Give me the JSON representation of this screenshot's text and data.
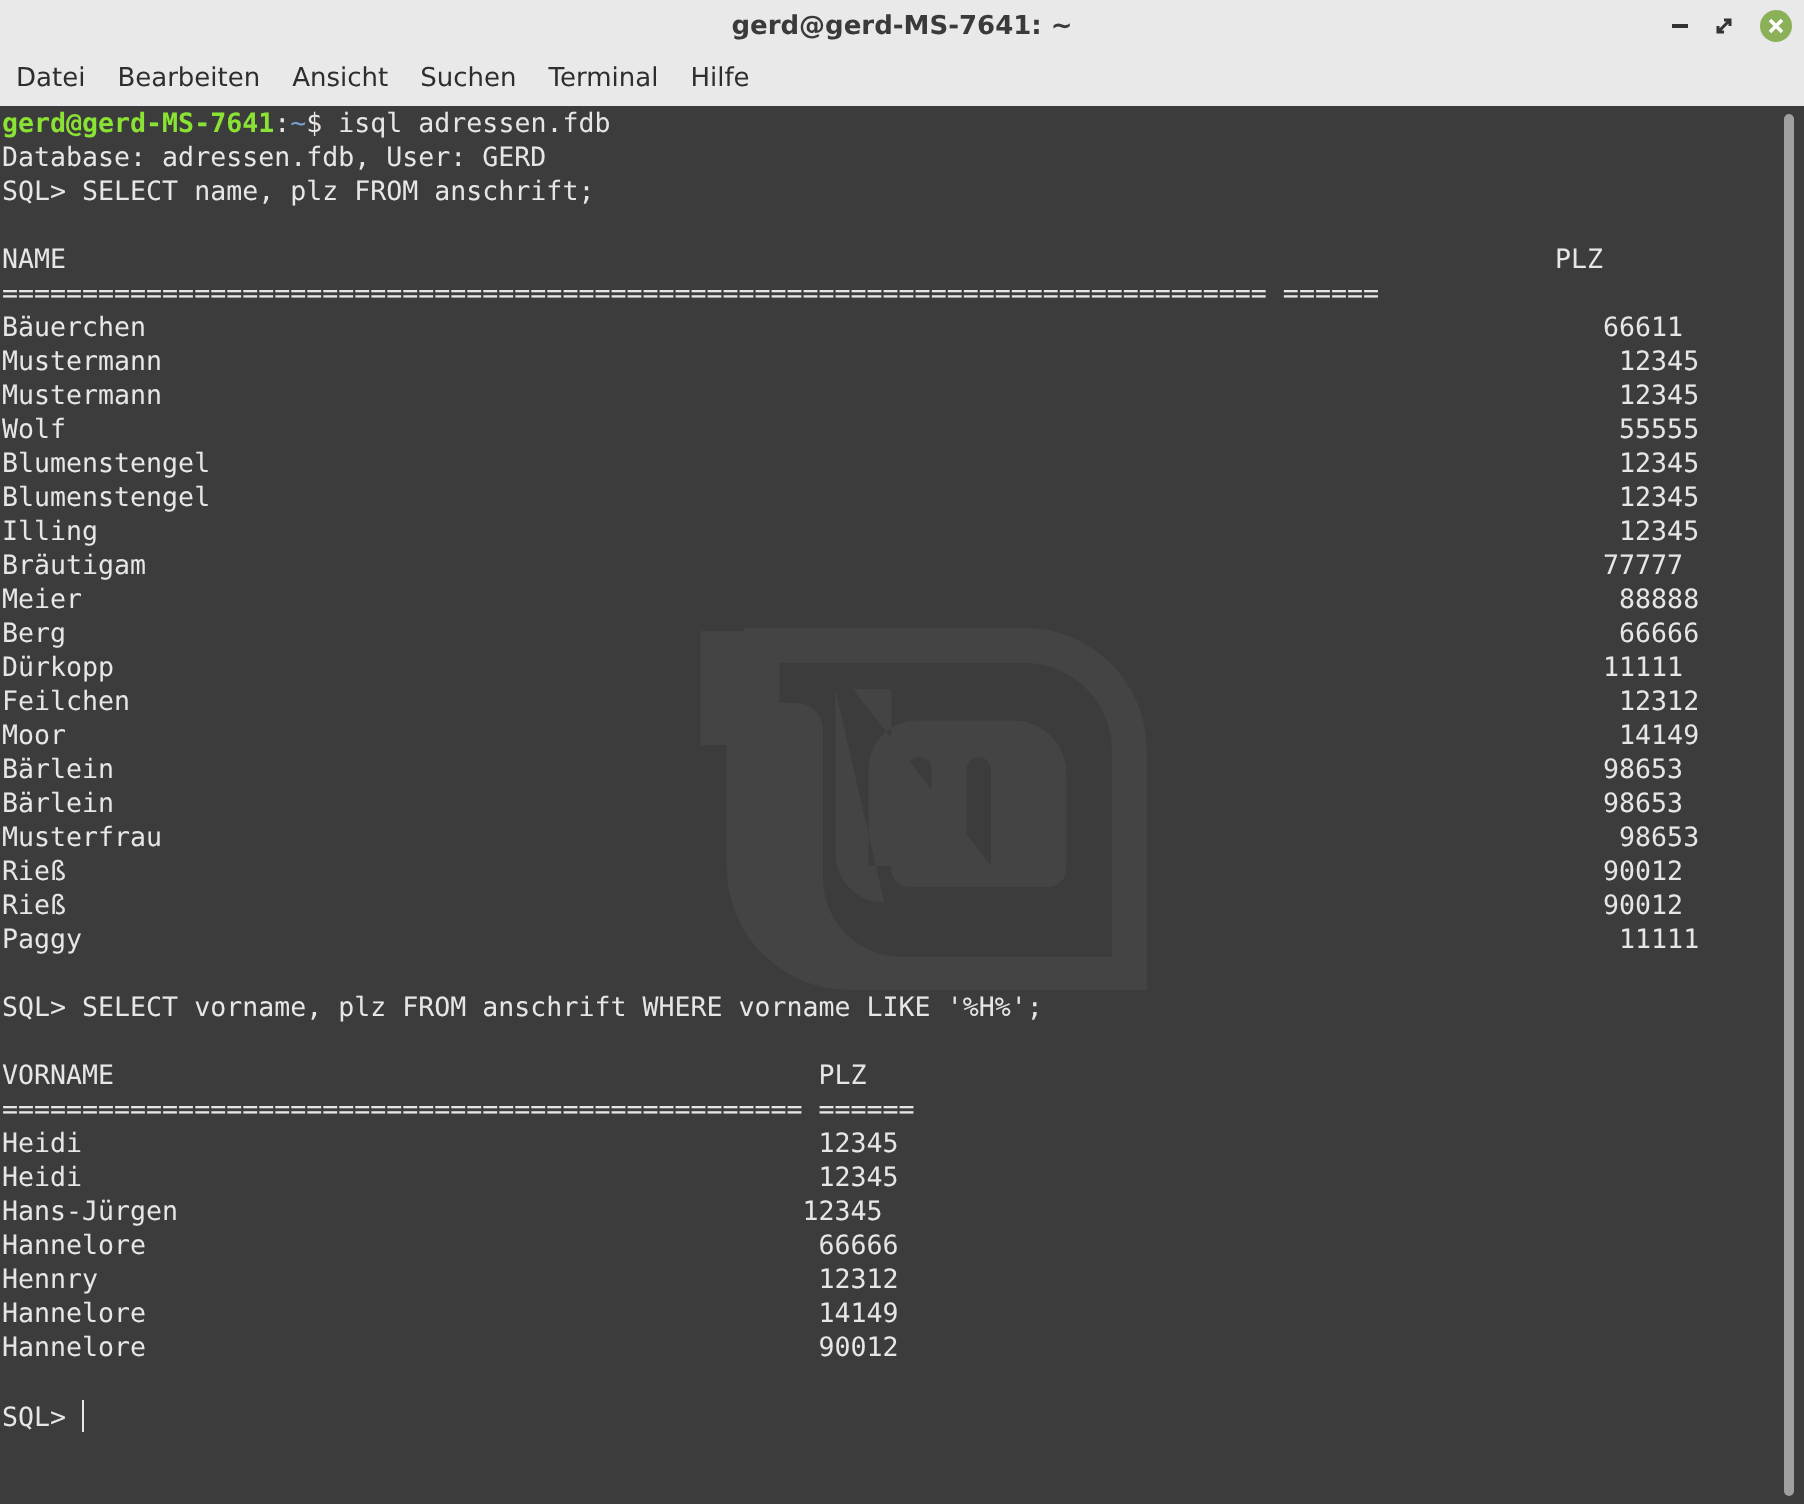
{
  "window": {
    "title": "gerd@gerd-MS-7641: ~"
  },
  "menu": [
    "Datei",
    "Bearbeiten",
    "Ansicht",
    "Suchen",
    "Terminal",
    "Hilfe"
  ],
  "terminal": {
    "lines": [
      {
        "kind": "prompt",
        "user_host": "gerd@gerd-MS-7641",
        "colon": ":",
        "path": "~",
        "command": "$ isql adressen.fdb"
      },
      {
        "kind": "output",
        "text": "Database: adressen.fdb, User: GERD"
      },
      {
        "kind": "output",
        "text": "SQL> SELECT name, plz FROM anschrift;"
      },
      {
        "kind": "blank"
      },
      {
        "kind": "output",
        "text": "NAME                                                                                             PLZ"
      },
      {
        "kind": "output",
        "text": "=============================================================================== ======"
      },
      {
        "kind": "output",
        "text": "Bäuerchen                                                                                           66611"
      },
      {
        "kind": "output",
        "text": "Mustermann                                                                                           12345"
      },
      {
        "kind": "output",
        "text": "Mustermann                                                                                           12345"
      },
      {
        "kind": "output",
        "text": "Wolf                                                                                                 55555"
      },
      {
        "kind": "output",
        "text": "Blumenstengel                                                                                        12345"
      },
      {
        "kind": "output",
        "text": "Blumenstengel                                                                                        12345"
      },
      {
        "kind": "output",
        "text": "Illing                                                                                               12345"
      },
      {
        "kind": "output",
        "text": "Bräutigam                                                                                           77777"
      },
      {
        "kind": "output",
        "text": "Meier                                                                                                88888"
      },
      {
        "kind": "output",
        "text": "Berg                                                                                                 66666"
      },
      {
        "kind": "output",
        "text": "Dürkopp                                                                                             11111"
      },
      {
        "kind": "output",
        "text": "Feilchen                                                                                             12312"
      },
      {
        "kind": "output",
        "text": "Moor                                                                                                 14149"
      },
      {
        "kind": "output",
        "text": "Bärlein                                                                                             98653"
      },
      {
        "kind": "output",
        "text": "Bärlein                                                                                             98653"
      },
      {
        "kind": "output",
        "text": "Musterfrau                                                                                           98653"
      },
      {
        "kind": "output",
        "text": "Rieß                                                                                                90012"
      },
      {
        "kind": "output",
        "text": "Rieß                                                                                                90012"
      },
      {
        "kind": "output",
        "text": "Paggy                                                                                                11111"
      },
      {
        "kind": "blank"
      },
      {
        "kind": "output",
        "text": "SQL> SELECT vorname, plz FROM anschrift WHERE vorname LIKE '%H%';"
      },
      {
        "kind": "blank"
      },
      {
        "kind": "output",
        "text": "VORNAME                                            PLZ"
      },
      {
        "kind": "output",
        "text": "================================================== ======"
      },
      {
        "kind": "output",
        "text": "Heidi                                              12345"
      },
      {
        "kind": "output",
        "text": "Heidi                                              12345"
      },
      {
        "kind": "output",
        "text": "Hans-Jürgen                                       12345"
      },
      {
        "kind": "output",
        "text": "Hannelore                                          66666"
      },
      {
        "kind": "output",
        "text": "Hennry                                             12312"
      },
      {
        "kind": "output",
        "text": "Hannelore                                          14149"
      },
      {
        "kind": "output",
        "text": "Hannelore                                          90012"
      },
      {
        "kind": "blank"
      },
      {
        "kind": "input",
        "text": "SQL>"
      }
    ]
  }
}
